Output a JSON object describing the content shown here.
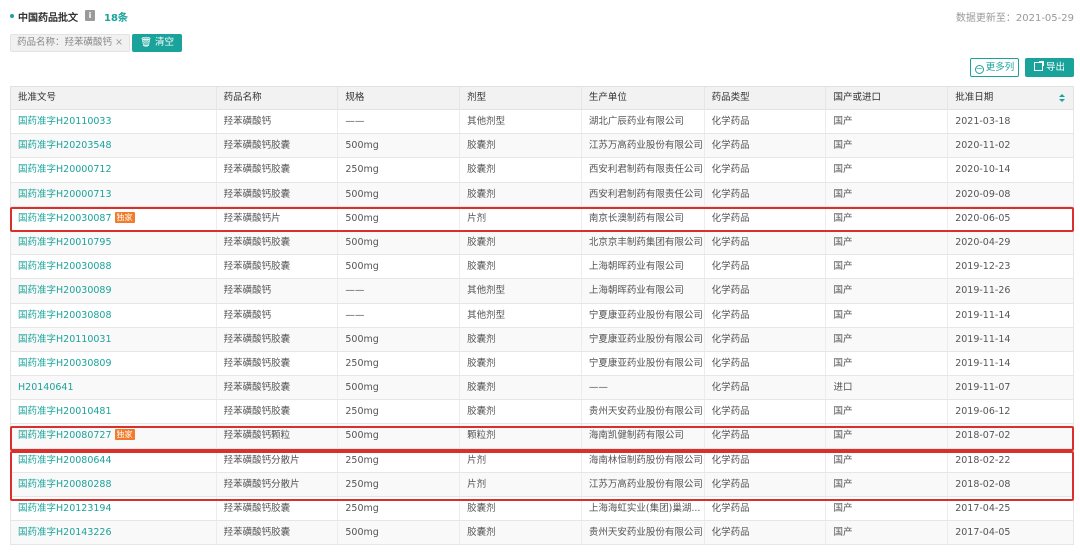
{
  "header": {
    "title": "中国药品批文",
    "info_icon": "info-icon",
    "count": "18条",
    "update_label": "数据更新至：2021-05-29"
  },
  "filter": {
    "chip_label": "药品名称：羟苯磺酸钙",
    "chip_close": "×",
    "clear_label": "清空"
  },
  "toolbar": {
    "more_columns": "更多列",
    "export": "导出"
  },
  "table": {
    "columns": [
      "批准文号",
      "药品名称",
      "规格",
      "剂型",
      "生产单位",
      "药品类型",
      "国产或进口",
      "批准日期"
    ],
    "sorted_column": "批准日期",
    "exclusive_tag": "独家",
    "rows": [
      {
        "approval": "国药准字H20110033",
        "name": "羟苯磺酸钙",
        "spec": "——",
        "form": "其他剂型",
        "maker": "湖北广辰药业有限公司",
        "type": "化学药品",
        "origin": "国产",
        "date": "2021-03-18",
        "exclusive": false
      },
      {
        "approval": "国药准字H20203548",
        "name": "羟苯磺酸钙胶囊",
        "spec": "500mg",
        "form": "胶囊剂",
        "maker": "江苏万高药业股份有限公司",
        "type": "化学药品",
        "origin": "国产",
        "date": "2020-11-02",
        "exclusive": false
      },
      {
        "approval": "国药准字H20000712",
        "name": "羟苯磺酸钙胶囊",
        "spec": "250mg",
        "form": "胶囊剂",
        "maker": "西安利君制药有限责任公司",
        "type": "化学药品",
        "origin": "国产",
        "date": "2020-10-14",
        "exclusive": false
      },
      {
        "approval": "国药准字H20000713",
        "name": "羟苯磺酸钙胶囊",
        "spec": "500mg",
        "form": "胶囊剂",
        "maker": "西安利君制药有限责任公司",
        "type": "化学药品",
        "origin": "国产",
        "date": "2020-09-08",
        "exclusive": false
      },
      {
        "approval": "国药准字H20030087",
        "name": "羟苯磺酸钙片",
        "spec": "500mg",
        "form": "片剂",
        "maker": "南京长澳制药有限公司",
        "type": "化学药品",
        "origin": "国产",
        "date": "2020-06-05",
        "exclusive": true
      },
      {
        "approval": "国药准字H20010795",
        "name": "羟苯磺酸钙胶囊",
        "spec": "500mg",
        "form": "胶囊剂",
        "maker": "北京京丰制药集团有限公司",
        "type": "化学药品",
        "origin": "国产",
        "date": "2020-04-29",
        "exclusive": false
      },
      {
        "approval": "国药准字H20030088",
        "name": "羟苯磺酸钙胶囊",
        "spec": "500mg",
        "form": "胶囊剂",
        "maker": "上海朝晖药业有限公司",
        "type": "化学药品",
        "origin": "国产",
        "date": "2019-12-23",
        "exclusive": false
      },
      {
        "approval": "国药准字H20030089",
        "name": "羟苯磺酸钙",
        "spec": "——",
        "form": "其他剂型",
        "maker": "上海朝晖药业有限公司",
        "type": "化学药品",
        "origin": "国产",
        "date": "2019-11-26",
        "exclusive": false
      },
      {
        "approval": "国药准字H20030808",
        "name": "羟苯磺酸钙",
        "spec": "——",
        "form": "其他剂型",
        "maker": "宁夏康亚药业股份有限公司",
        "type": "化学药品",
        "origin": "国产",
        "date": "2019-11-14",
        "exclusive": false
      },
      {
        "approval": "国药准字H20110031",
        "name": "羟苯磺酸钙胶囊",
        "spec": "500mg",
        "form": "胶囊剂",
        "maker": "宁夏康亚药业股份有限公司",
        "type": "化学药品",
        "origin": "国产",
        "date": "2019-11-14",
        "exclusive": false
      },
      {
        "approval": "国药准字H20030809",
        "name": "羟苯磺酸钙胶囊",
        "spec": "250mg",
        "form": "胶囊剂",
        "maker": "宁夏康亚药业股份有限公司",
        "type": "化学药品",
        "origin": "国产",
        "date": "2019-11-14",
        "exclusive": false
      },
      {
        "approval": "H20140641",
        "name": "羟苯磺酸钙胶囊",
        "spec": "500mg",
        "form": "胶囊剂",
        "maker": "——",
        "type": "化学药品",
        "origin": "进口",
        "date": "2019-11-07",
        "exclusive": false
      },
      {
        "approval": "国药准字H20010481",
        "name": "羟苯磺酸钙胶囊",
        "spec": "250mg",
        "form": "胶囊剂",
        "maker": "贵州天安药业股份有限公司",
        "type": "化学药品",
        "origin": "国产",
        "date": "2019-06-12",
        "exclusive": false
      },
      {
        "approval": "国药准字H20080727",
        "name": "羟苯磺酸钙颗粒",
        "spec": "500mg",
        "form": "颗粒剂",
        "maker": "海南凯健制药有限公司",
        "type": "化学药品",
        "origin": "国产",
        "date": "2018-07-02",
        "exclusive": true
      },
      {
        "approval": "国药准字H20080644",
        "name": "羟苯磺酸钙分散片",
        "spec": "250mg",
        "form": "片剂",
        "maker": "海南林恒制药股份有限公司",
        "type": "化学药品",
        "origin": "国产",
        "date": "2018-02-22",
        "exclusive": false
      },
      {
        "approval": "国药准字H20080288",
        "name": "羟苯磺酸钙分散片",
        "spec": "250mg",
        "form": "片剂",
        "maker": "江苏万高药业股份有限公司",
        "type": "化学药品",
        "origin": "国产",
        "date": "2018-02-08",
        "exclusive": false
      },
      {
        "approval": "国药准字H20123194",
        "name": "羟苯磺酸钙胶囊",
        "spec": "250mg",
        "form": "胶囊剂",
        "maker": "上海海虹实业(集团)巢湖...",
        "type": "化学药品",
        "origin": "国产",
        "date": "2017-04-25",
        "exclusive": false
      },
      {
        "approval": "国药准字H20143226",
        "name": "羟苯磺酸钙胶囊",
        "spec": "500mg",
        "form": "胶囊剂",
        "maker": "贵州天安药业股份有限公司",
        "type": "化学药品",
        "origin": "国产",
        "date": "2017-04-05",
        "exclusive": false
      }
    ]
  },
  "highlight_color": "#d9302c",
  "accent_color": "#1aa39a"
}
